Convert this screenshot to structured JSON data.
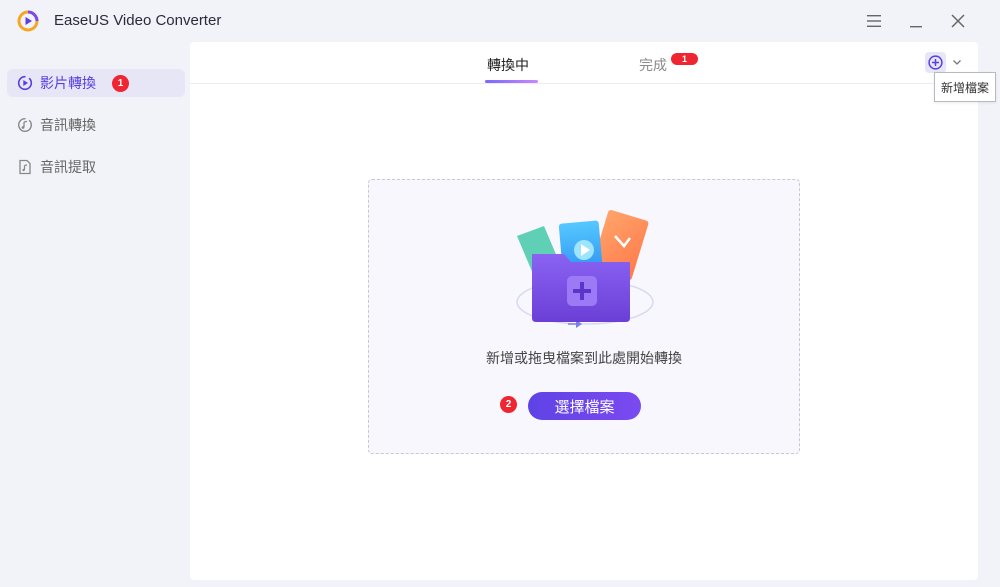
{
  "app": {
    "title": "EaseUS Video Converter",
    "accent_color": "#5b3ee0"
  },
  "window_controls": {
    "menu_icon": "hamburger-icon",
    "minimize_icon": "minimize-icon",
    "close_icon": "close-icon"
  },
  "sidebar": {
    "items": [
      {
        "label": "影片轉換",
        "icon": "video-convert-icon",
        "active": true,
        "badge": "1"
      },
      {
        "label": "音訊轉換",
        "icon": "audio-convert-icon",
        "active": false
      },
      {
        "label": "音訊提取",
        "icon": "audio-extract-icon",
        "active": false
      }
    ]
  },
  "main": {
    "tabs": [
      {
        "label": "轉換中",
        "active": true
      },
      {
        "label": "完成",
        "active": false,
        "badge": "1"
      }
    ],
    "add_file_tooltip": "新增檔案",
    "dropzone": {
      "text": "新增或拖曳檔案到此處開始轉換",
      "button_label": "選擇檔案",
      "button_badge": "2"
    }
  }
}
